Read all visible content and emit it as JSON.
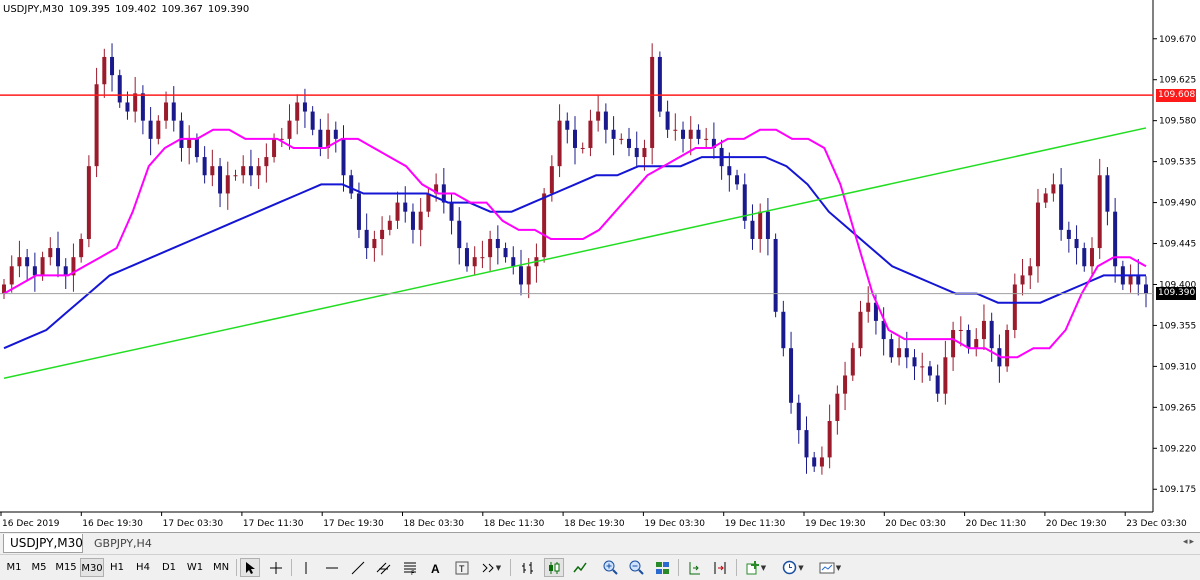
{
  "symbol_label": "USDJPY,M30",
  "ohlc": {
    "open": "109.395",
    "high": "109.402",
    "low": "109.367",
    "close": "109.390"
  },
  "colors": {
    "up_candle": "#9a1b2b",
    "down_candle": "#1a1a8c",
    "ma_fast": "#ff00ff",
    "ma_slow": "#1515d4",
    "trendline": "#22dd22",
    "resistance": "#ff1a1a",
    "current_price": "#a0a0a0"
  },
  "chart_data": {
    "type": "candlestick",
    "timeframe": "M30",
    "ylim": [
      109.15,
      109.695
    ],
    "y_ticks": [
      "109.670",
      "109.625",
      "109.580",
      "109.535",
      "109.490",
      "109.445",
      "109.400",
      "109.355",
      "109.310",
      "109.265",
      "109.220",
      "109.175"
    ],
    "x_ticks": [
      "16 Dec 2019",
      "16 Dec 19:30",
      "17 Dec 03:30",
      "17 Dec 11:30",
      "17 Dec 19:30",
      "18 Dec 03:30",
      "18 Dec 11:30",
      "18 Dec 19:30",
      "19 Dec 03:30",
      "19 Dec 11:30",
      "19 Dec 19:30",
      "20 Dec 03:30",
      "20 Dec 11:30",
      "20 Dec 19:30",
      "23 Dec 03:30"
    ],
    "resistance_price": "109.608",
    "resistance_value": 109.608,
    "current_price": "109.390",
    "current_value": 109.39,
    "trendline": {
      "from": [
        0,
        109.297
      ],
      "to": [
        148,
        109.572
      ]
    },
    "closes": [
      109.4,
      109.42,
      109.43,
      109.42,
      109.41,
      109.43,
      109.44,
      109.42,
      109.41,
      109.43,
      109.45,
      109.53,
      109.62,
      109.65,
      109.63,
      109.6,
      109.59,
      109.61,
      109.58,
      109.56,
      109.58,
      109.6,
      109.58,
      109.55,
      109.56,
      109.54,
      109.52,
      109.53,
      109.5,
      109.52,
      109.52,
      109.53,
      109.52,
      109.53,
      109.54,
      109.56,
      109.56,
      109.58,
      109.6,
      109.59,
      109.57,
      109.55,
      109.57,
      109.56,
      109.52,
      109.5,
      109.46,
      109.44,
      109.45,
      109.46,
      109.47,
      109.49,
      109.48,
      109.46,
      109.48,
      109.5,
      109.51,
      109.49,
      109.47,
      109.44,
      109.42,
      109.43,
      109.43,
      109.45,
      109.44,
      109.43,
      109.42,
      109.4,
      109.42,
      109.43,
      109.5,
      109.53,
      109.58,
      109.57,
      109.55,
      109.55,
      109.58,
      109.59,
      109.57,
      109.56,
      109.56,
      109.55,
      109.54,
      109.55,
      109.65,
      109.59,
      109.57,
      109.57,
      109.56,
      109.57,
      109.56,
      109.56,
      109.55,
      109.53,
      109.52,
      109.51,
      109.47,
      109.45,
      109.48,
      109.45,
      109.37,
      109.33,
      109.27,
      109.24,
      109.21,
      109.2,
      109.21,
      109.25,
      109.28,
      109.3,
      109.33,
      109.37,
      109.38,
      109.36,
      109.34,
      109.32,
      109.33,
      109.32,
      109.31,
      109.31,
      109.3,
      109.28,
      109.32,
      109.35,
      109.35,
      109.33,
      109.34,
      109.36,
      109.33,
      109.31,
      109.35,
      109.4,
      109.41,
      109.42,
      109.49,
      109.5,
      109.51,
      109.46,
      109.45,
      109.44,
      109.42,
      109.44,
      109.52,
      109.48,
      109.42,
      109.4,
      109.41,
      109.4,
      109.39
    ],
    "ma_fast": [
      109.39,
      109.4,
      109.41,
      109.41,
      109.41,
      109.42,
      109.43,
      109.44,
      109.48,
      109.53,
      109.55,
      109.56,
      109.56,
      109.57,
      109.57,
      109.56,
      109.56,
      109.56,
      109.55,
      109.55,
      109.55,
      109.56,
      109.56,
      109.55,
      109.54,
      109.53,
      109.51,
      109.5,
      109.5,
      109.49,
      109.49,
      109.47,
      109.46,
      109.46,
      109.45,
      109.45,
      109.45,
      109.46,
      109.48,
      109.5,
      109.52,
      109.53,
      109.54,
      109.55,
      109.55,
      109.56,
      109.56,
      109.57,
      109.57,
      109.56,
      109.56,
      109.55,
      109.51,
      109.45,
      109.39,
      109.35,
      109.34,
      109.34,
      109.34,
      109.34,
      109.33,
      109.33,
      109.32,
      109.32,
      109.33,
      109.33,
      109.35,
      109.39,
      109.42,
      109.43,
      109.43,
      109.42
    ],
    "ma_slow": [
      109.33,
      109.34,
      109.35,
      109.37,
      109.39,
      109.41,
      109.42,
      109.43,
      109.44,
      109.45,
      109.46,
      109.47,
      109.48,
      109.49,
      109.5,
      109.51,
      109.51,
      109.5,
      109.5,
      109.5,
      109.5,
      109.49,
      109.49,
      109.48,
      109.48,
      109.49,
      109.5,
      109.51,
      109.52,
      109.52,
      109.53,
      109.53,
      109.53,
      109.54,
      109.54,
      109.54,
      109.54,
      109.53,
      109.51,
      109.48,
      109.46,
      109.44,
      109.42,
      109.41,
      109.4,
      109.39,
      109.39,
      109.38,
      109.38,
      109.38,
      109.39,
      109.4,
      109.41,
      109.41,
      109.41
    ]
  },
  "tabs": [
    {
      "label": "USDJPY,M30"
    },
    {
      "label": "GBPJPY,H4"
    }
  ],
  "timeframes": [
    "M1",
    "M5",
    "M15",
    "M30",
    "H1",
    "H4",
    "D1",
    "W1",
    "MN"
  ],
  "active_timeframe": "M30"
}
